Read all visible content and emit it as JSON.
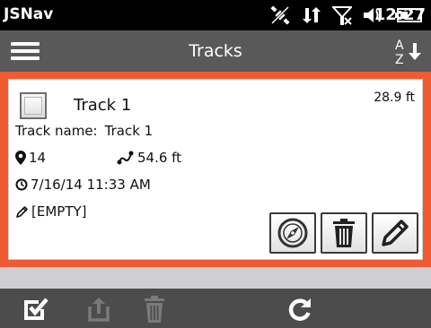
{
  "status_bar": {
    "app_name": "JSNav",
    "time": "12:27"
  },
  "header": {
    "title": "Tracks",
    "sort_label_top": "A",
    "sort_label_bottom": "Z"
  },
  "track": {
    "title": "Track 1",
    "size": "28.9 ft",
    "name_label": "Track name:",
    "name_value": "Track 1",
    "points": "14",
    "distance": "54.6 ft",
    "datetime": "7/16/14 11:33 AM",
    "note": "[EMPTY]"
  },
  "colors": {
    "selection_border": "#f05a32",
    "header_bg": "#595959",
    "toolbar_bg": "#4c4c4c"
  },
  "icons": {
    "menu": "hamburger-icon",
    "sort": "sort-az-icon",
    "points": "map-pin-icon",
    "distance": "route-icon",
    "date": "clock-icon",
    "note": "pencil-icon",
    "navigate": "compass-icon",
    "delete": "trash-icon",
    "edit": "edit-pencil-icon",
    "select": "checkbox-select-icon",
    "export": "export-icon",
    "refresh": "refresh-icon"
  }
}
